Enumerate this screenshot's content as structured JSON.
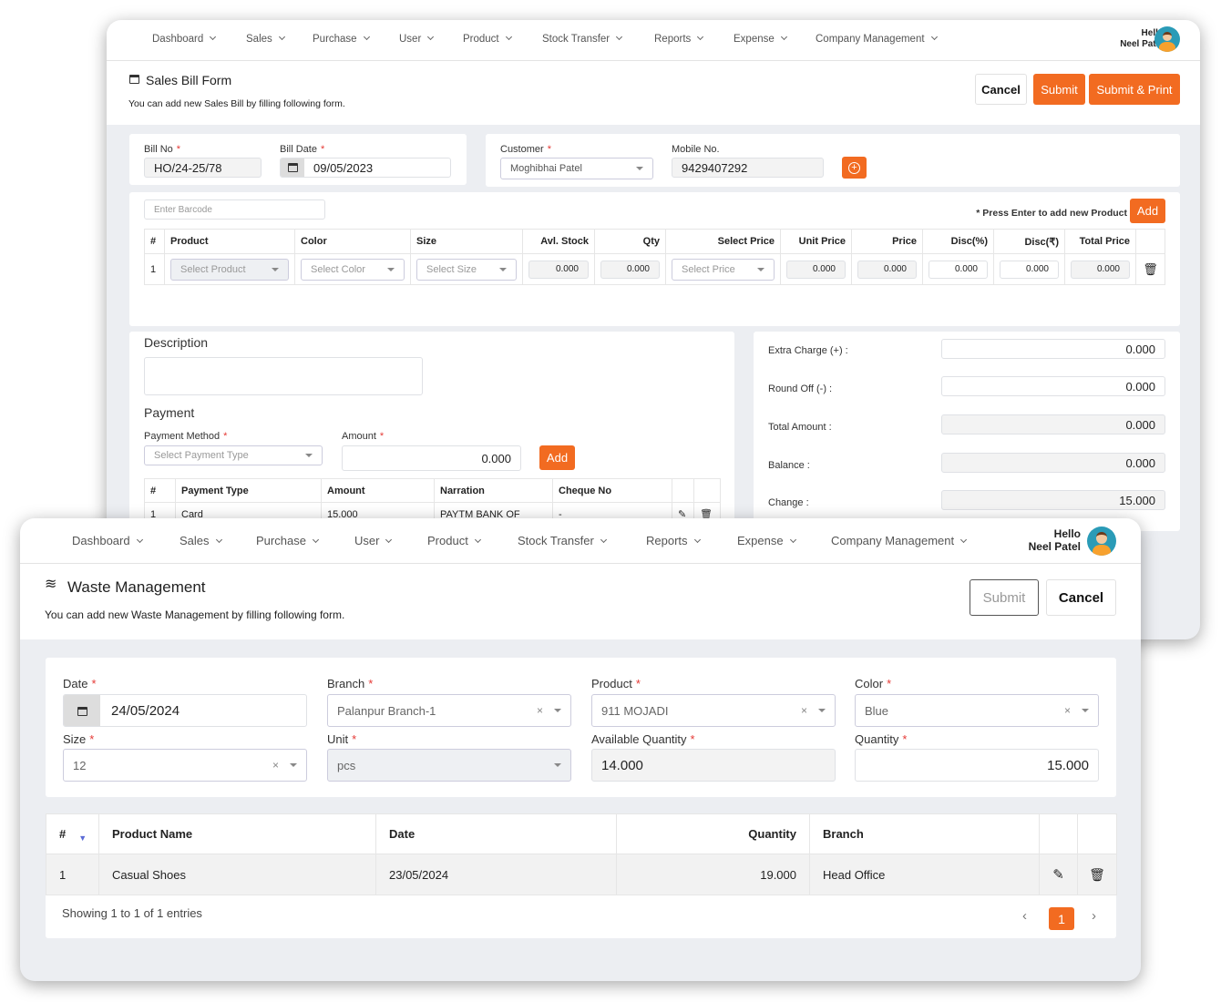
{
  "colors": {
    "accent": "#f26b21",
    "background": "#eceef2"
  },
  "nav": {
    "items": [
      "Dashboard",
      "Sales",
      "Purchase",
      "User",
      "Product",
      "Stock Transfer",
      "Reports",
      "Expense",
      "Company Management"
    ],
    "greeting": "Hello",
    "user": "Neel Patel"
  },
  "sales": {
    "title": "Sales Bill Form",
    "subtitle": "You can add new Sales Bill by filling following form.",
    "cancel": "Cancel",
    "submit": "Submit",
    "submit_print": "Submit & Print",
    "bill_no_label": "Bill No",
    "bill_no": "HO/24-25/78",
    "bill_date_label": "Bill Date",
    "bill_date": "09/05/2023",
    "customer_label": "Customer",
    "customer": "Moghibhai Patel",
    "mobile_label": "Mobile No.",
    "mobile": "9429407292",
    "barcode_placeholder": "Enter Barcode",
    "press_enter": "* Press Enter to add new Product",
    "add": "Add",
    "columns": [
      "#",
      "Product",
      "Color",
      "Size",
      "Avl. Stock",
      "Qty",
      "Select Price",
      "Unit Price",
      "Price",
      "Disc(%)",
      "Disc(₹)",
      "Total Price"
    ],
    "row": {
      "index": "1",
      "product": "Select Product",
      "color": "Select Color",
      "size": "Select Size",
      "avl_stock": "0.000",
      "qty": "0.000",
      "select_price": "Select Price",
      "unit_price": "0.000",
      "price": "0.000",
      "disc_pct": "0.000",
      "disc_amt": "0.000",
      "total": "0.000"
    },
    "description_label": "Description",
    "payment_label": "Payment",
    "payment_method_label": "Payment Method",
    "payment_method_placeholder": "Select Payment Type",
    "amount_label": "Amount",
    "amount": "0.000",
    "payment_columns": [
      "#",
      "Payment Type",
      "Amount",
      "Narration",
      "Cheque No"
    ],
    "payment_row": {
      "index": "1",
      "type": "Card",
      "amount": "15.000",
      "narration": "PAYTM BANK OF",
      "cheque": "-"
    },
    "summary": [
      {
        "label": "Extra Charge (+) :",
        "value": "0.000"
      },
      {
        "label": "Round Off (-) :",
        "value": "0.000"
      },
      {
        "label": "Total Amount :",
        "value": "0.000"
      },
      {
        "label": "Balance :",
        "value": "0.000"
      },
      {
        "label": "Change :",
        "value": "15.000"
      }
    ]
  },
  "waste": {
    "title": "Waste Management",
    "subtitle": "You can add new Waste Management by filling following form.",
    "submit": "Submit",
    "cancel": "Cancel",
    "date_label": "Date",
    "date": "24/05/2024",
    "branch_label": "Branch",
    "branch": "Palanpur Branch-1",
    "product_label": "Product",
    "product": "911 MOJADI",
    "color_label": "Color",
    "color": "Blue",
    "size_label": "Size",
    "size": "12",
    "unit_label": "Unit",
    "unit": "pcs",
    "avail_label": "Available Quantity",
    "avail": "14.000",
    "qty_label": "Quantity",
    "qty": "15.000",
    "columns": [
      "#",
      "Product Name",
      "Date",
      "Quantity",
      "Branch"
    ],
    "rows": [
      {
        "index": "1",
        "product": "Casual Shoes",
        "date": "23/05/2024",
        "quantity": "19.000",
        "branch": "Head Office"
      }
    ],
    "showing": "Showing 1 to 1 of 1 entries",
    "page": "1"
  }
}
